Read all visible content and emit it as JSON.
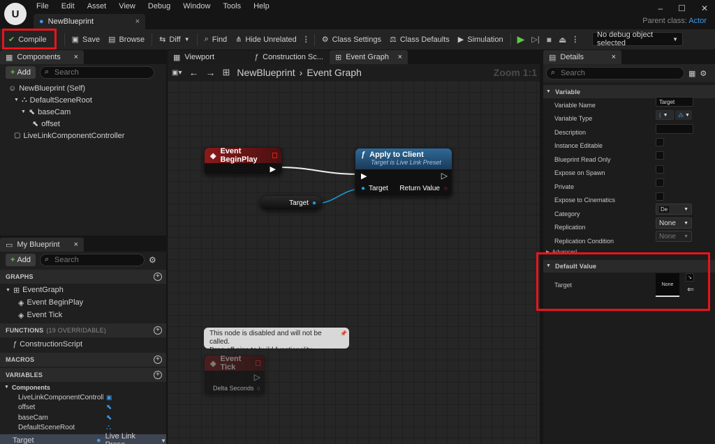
{
  "menu": [
    "File",
    "Edit",
    "Asset",
    "View",
    "Debug",
    "Window",
    "Tools",
    "Help"
  ],
  "document_tab": "NewBlueprint",
  "parent_class": {
    "label": "Parent class:",
    "value": "Actor"
  },
  "toolbar": {
    "compile": "Compile",
    "save": "Save",
    "browse": "Browse",
    "diff": "Diff",
    "find": "Find",
    "hide_unrelated": "Hide Unrelated",
    "class_settings": "Class Settings",
    "class_defaults": "Class Defaults",
    "simulation": "Simulation",
    "debug_object": "No debug object selected"
  },
  "components": {
    "tab": "Components",
    "add": "Add",
    "search_placeholder": "Search",
    "items": [
      "NewBlueprint (Self)",
      "DefaultSceneRoot",
      "baseCam",
      "offset",
      "LiveLinkComponentController"
    ]
  },
  "my_blueprint": {
    "tab": "My Blueprint",
    "add": "Add",
    "search_placeholder": "Search",
    "graphs_header": "GRAPHS",
    "graph_name": "EventGraph",
    "events": [
      "Event BeginPlay",
      "Event Tick"
    ],
    "functions_header": "FUNCTIONS",
    "functions_count": "(19 OVERRIDABLE)",
    "functions": [
      "ConstructionScript"
    ],
    "macros_header": "MACROS",
    "variables_header": "VARIABLES",
    "components_category": "Components",
    "variables": [
      "LiveLinkComponentControlle",
      "offset",
      "baseCam",
      "DefaultSceneRoot"
    ],
    "selected_variable": {
      "name": "Target",
      "type": "Live Link Prese"
    }
  },
  "graph_tabs": [
    "Viewport",
    "Construction Sc...",
    "Event Graph"
  ],
  "graph_breadcrumb": {
    "root": "NewBlueprint",
    "current": "Event Graph"
  },
  "zoom": "Zoom 1:1",
  "nodes": {
    "begin_play": "Event BeginPlay",
    "apply": {
      "title": "Apply to Client",
      "subtitle": "Target is Live Link Preset",
      "pin_target": "Target",
      "pin_return": "Return Value"
    },
    "target_getter": "Target",
    "disabled_comment": [
      "This node is disabled and will not be called.",
      "Drag off pins to build functionality."
    ],
    "event_tick": "Event Tick",
    "delta_seconds": "Delta Seconds"
  },
  "details": {
    "tab": "Details",
    "search_placeholder": "Search",
    "variable_section": "Variable",
    "props": [
      "Variable Name",
      "Variable Type",
      "Description",
      "Instance Editable",
      "Blueprint Read Only",
      "Expose on Spawn",
      "Private",
      "Expose to Cinematics",
      "Category",
      "Replication",
      "Replication Condition"
    ],
    "variable_name_value": "Target",
    "category_value": "De",
    "replication_value": "None",
    "replication_condition_value": "None",
    "advanced": "Advanced",
    "default_value_section": "Default Value",
    "default_target_label": "Target",
    "default_target_value": "None"
  },
  "colors": {
    "accent": "#3a9af0",
    "red_highlight": "#e8141c",
    "event_node": "#8a1a1a",
    "function_node": "#2a5a80"
  }
}
